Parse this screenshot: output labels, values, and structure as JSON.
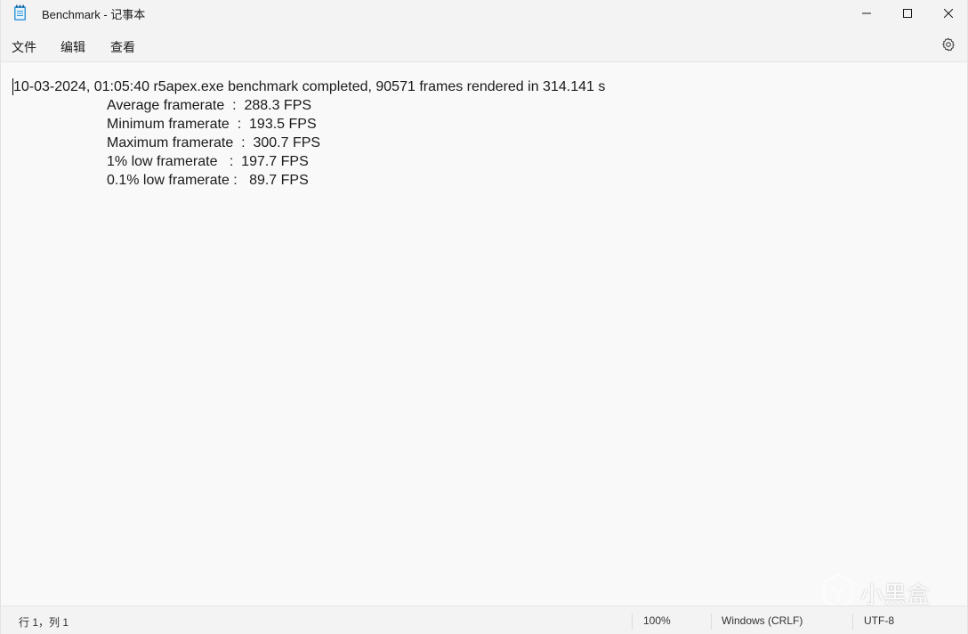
{
  "window": {
    "title": "Benchmark - 记事本",
    "app_icon": "notepad-icon"
  },
  "menu": {
    "file": "文件",
    "edit": "编辑",
    "view": "查看",
    "settings_icon": "gear-icon"
  },
  "editor": {
    "lines": [
      "10-03-2024, 01:05:40 r5apex.exe benchmark completed, 90571 frames rendered in 314.141 s",
      "Average framerate  :  288.3 FPS",
      "Minimum framerate  :  193.5 FPS",
      "Maximum framerate  :  300.7 FPS",
      "1% low framerate   :  197.7 FPS",
      "0.1% low framerate :   89.7 FPS"
    ]
  },
  "statusbar": {
    "position": "行 1，列 1",
    "zoom": "100%",
    "line_ending": "Windows (CRLF)",
    "encoding": "UTF-8"
  },
  "watermark": {
    "text": "小黑盒"
  }
}
